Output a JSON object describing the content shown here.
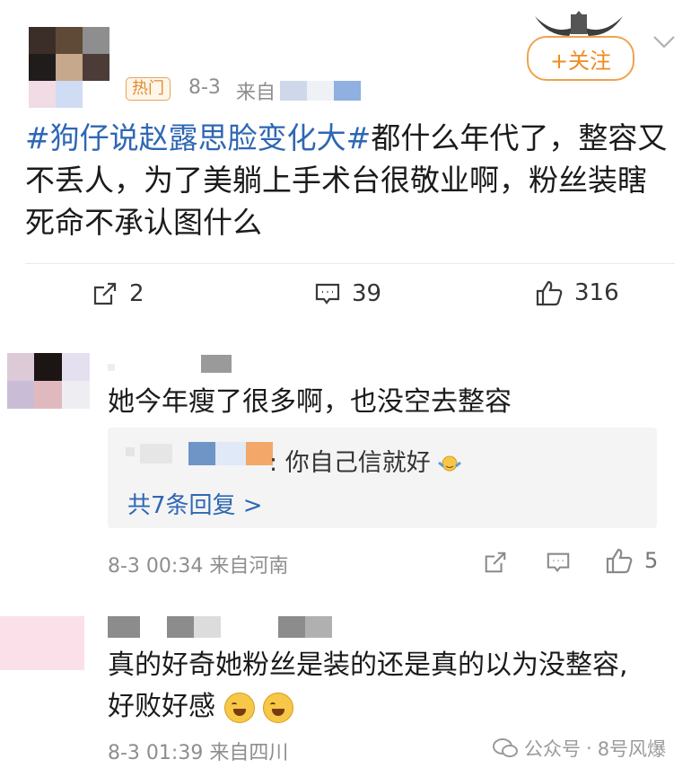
{
  "post": {
    "badge": "热门",
    "date": "8-3",
    "source_prefix": "来自",
    "follow_label": "+关注",
    "hashtag": "#狗仔说赵露思脸变化大#",
    "text": "都什么年代了，整容又不丢人，为了美躺上手术台很敬业啊，粉丝装瞎死命不承认图什么",
    "repost_count": "2",
    "comment_count": "39",
    "like_count": "316"
  },
  "comments": [
    {
      "text": "她今年瘦了很多啊，也没空去整容",
      "reply_preview": {
        "separator": ":",
        "text": "你自己信就好"
      },
      "reply_link": "共7条回复 >",
      "timestamp": "8-3 00:34 来自河南",
      "like_count": "5"
    },
    {
      "text_line1": "真的好奇她粉丝是装的还是真的以为没整容,",
      "text_line2": "好败好感",
      "timestamp": "8-3 01:39 来自四川"
    }
  ],
  "watermark": {
    "text1": "公众号",
    "dot": "·",
    "text2": "8号风爆"
  },
  "colors": {
    "hashtag_blue": "#2f67b3",
    "follow_orange": "#f08a1f",
    "meta_gray": "#8e8e8e",
    "reply_bg": "#f4f4f4"
  },
  "icons": [
    "chevron-down-icon",
    "repost-icon",
    "comment-icon",
    "like-icon",
    "emoji-shrug-icon",
    "emoji-laugh-cry-icon",
    "wechat-icon"
  ]
}
